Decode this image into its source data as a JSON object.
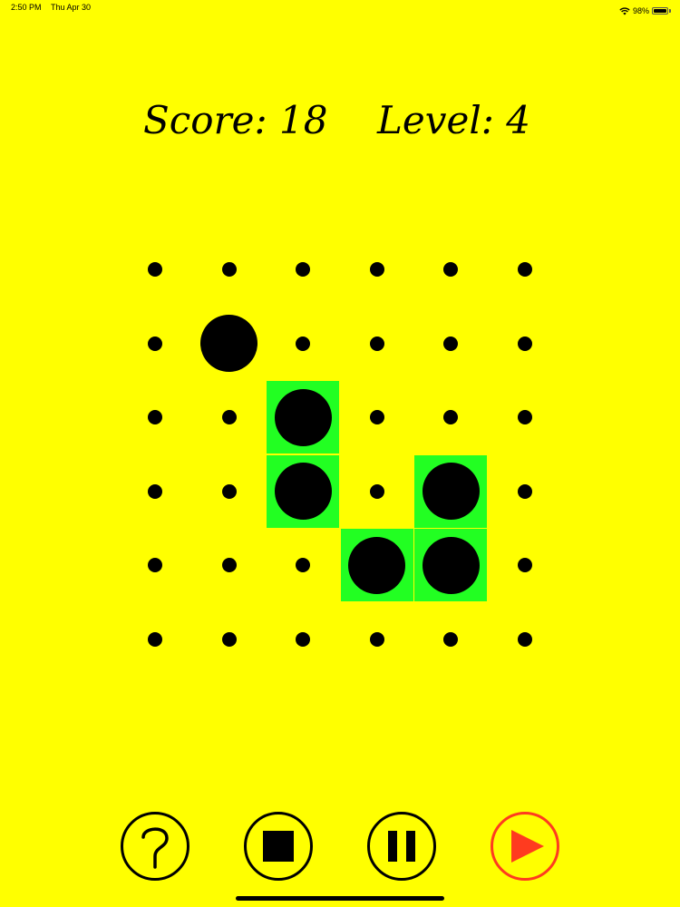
{
  "status_bar": {
    "time": "2:50 PM",
    "date": "Thu Apr 30",
    "battery": "98%",
    "battery_fraction": 0.98,
    "wifi_icon": "wifi-icon",
    "battery_icon": "battery-icon"
  },
  "hud": {
    "score": "Score: 18",
    "level": "Level: 4"
  },
  "board": {
    "rows": 6,
    "cols": 6,
    "green_cells": [
      [
        2,
        2
      ],
      [
        3,
        2
      ],
      [
        3,
        4
      ],
      [
        4,
        3
      ],
      [
        4,
        4
      ]
    ],
    "large_dots": [
      [
        1,
        1
      ],
      [
        2,
        2
      ],
      [
        3,
        2
      ],
      [
        3,
        4
      ],
      [
        4,
        3
      ],
      [
        4,
        4
      ]
    ],
    "tile_color": "#22FF22",
    "dot_color": "#000000"
  },
  "controls": {
    "help_icon": "question-mark-icon",
    "stop_icon": "stop-icon",
    "pause_icon": "pause-icon",
    "play_icon": "play-icon",
    "play_color": "#FF3B1F"
  },
  "colors": {
    "background": "#FFFF00"
  }
}
